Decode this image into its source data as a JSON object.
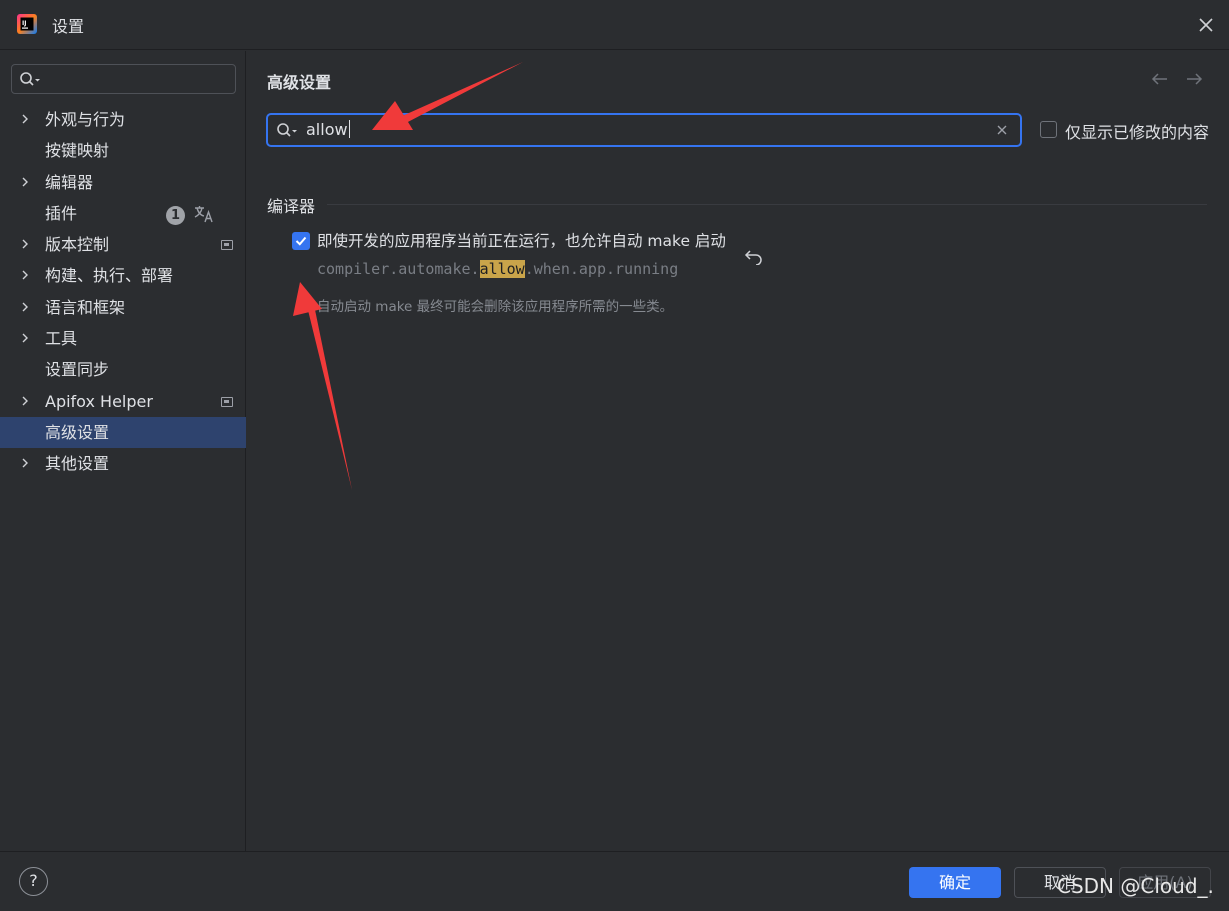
{
  "window": {
    "title": "设置"
  },
  "sidebar": {
    "search_placeholder": "",
    "items": [
      {
        "label": "外观与行为",
        "expandable": true
      },
      {
        "label": "按键映射",
        "expandable": false
      },
      {
        "label": "编辑器",
        "expandable": true
      },
      {
        "label": "插件",
        "expandable": false,
        "badge": "1",
        "extra_icon": "translate-icon"
      },
      {
        "label": "版本控制",
        "expandable": true,
        "extra_icon": "project-settings-icon"
      },
      {
        "label": "构建、执行、部署",
        "expandable": true
      },
      {
        "label": "语言和框架",
        "expandable": true
      },
      {
        "label": "工具",
        "expandable": true
      },
      {
        "label": "设置同步",
        "expandable": false
      },
      {
        "label": "Apifox Helper",
        "expandable": true,
        "extra_icon": "project-settings-icon"
      },
      {
        "label": "高级设置",
        "expandable": false,
        "selected": true
      },
      {
        "label": "其他设置",
        "expandable": true
      }
    ]
  },
  "main": {
    "title": "高级设置",
    "search": {
      "value": "allow"
    },
    "show_modified_only": {
      "label": "仅显示已修改的内容",
      "checked": false
    },
    "section": {
      "label": "编译器",
      "option": {
        "label": "即使开发的应用程序当前正在运行，也允许自动 make 启动",
        "checked": true,
        "key_prefix": "compiler.automake.",
        "key_match": "allow",
        "key_suffix": ".when.app.running",
        "description": "自动启动 make 最终可能会删除该应用程序所需的一些类。"
      }
    }
  },
  "footer": {
    "help": "?",
    "ok": "确定",
    "cancel": "取消",
    "apply": "应用(A)"
  },
  "watermark": "CSDN @Cloud_.",
  "colors": {
    "accent": "#3574f0",
    "selected_row": "#2e436e",
    "highlight": "#c9a44a",
    "annotation_arrow": "#f03a3a"
  }
}
